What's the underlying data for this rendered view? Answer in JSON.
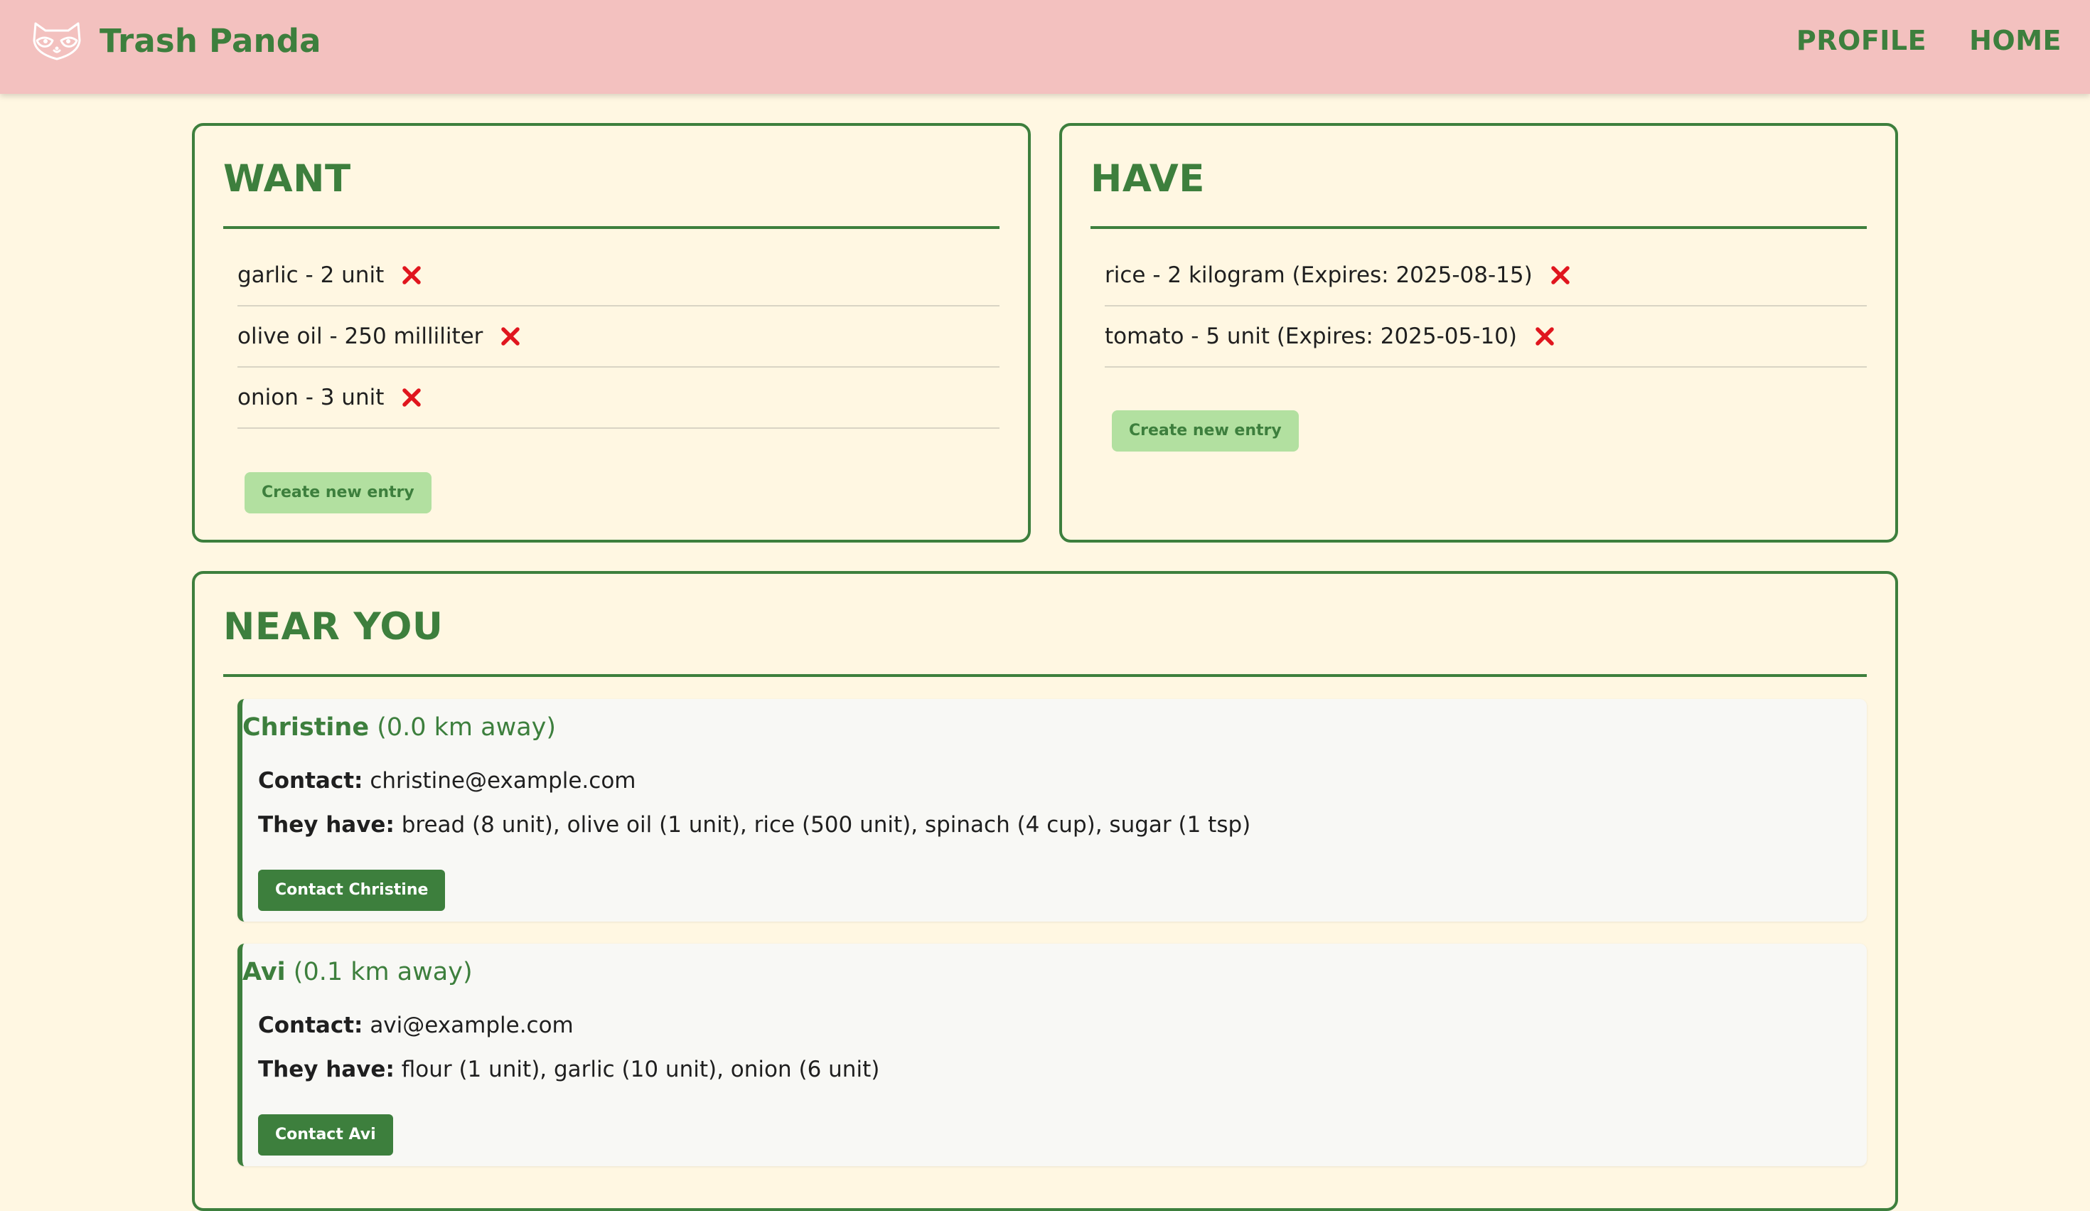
{
  "header": {
    "brand_name": "Trash Panda",
    "logo_icon": "raccoon-icon",
    "nav": [
      {
        "label": "PROFILE"
      },
      {
        "label": "HOME"
      }
    ]
  },
  "want": {
    "title": "WANT",
    "entries": [
      {
        "text": "garlic - 2 unit"
      },
      {
        "text": "olive oil - 250 milliliter"
      },
      {
        "text": "onion - 3 unit"
      }
    ],
    "remove_icon": "close-icon",
    "create_label": "Create new entry"
  },
  "have": {
    "title": "HAVE",
    "entries": [
      {
        "text": "rice - 2 kilogram (Expires: 2025-08-15)"
      },
      {
        "text": "tomato - 5 unit (Expires: 2025-05-10)"
      }
    ],
    "remove_icon": "close-icon",
    "create_label": "Create new entry"
  },
  "near": {
    "title": "NEAR YOU",
    "contact_label": "Contact:",
    "have_label": "They have:",
    "users": [
      {
        "name": "Christine",
        "distance": "(0.0 km away)",
        "email": "christine@example.com",
        "items": "bread (8 unit), olive oil (1 unit), rice (500 unit), spinach (4 cup), sugar (1 tsp)",
        "button": "Contact Christine"
      },
      {
        "name": "Avi",
        "distance": "(0.1 km away)",
        "email": "avi@example.com",
        "items": "flour (1 unit), garlic (10 unit), onion (6 unit)",
        "button": "Contact Avi"
      }
    ]
  },
  "colors": {
    "header_bg": "#f3c1bf",
    "page_bg": "#fff7e2",
    "brand_green": "#3d7f3d",
    "light_green_button": "#b2e0a0",
    "remove_red": "#e0161e",
    "user_card_bg": "#f8f8f5"
  }
}
